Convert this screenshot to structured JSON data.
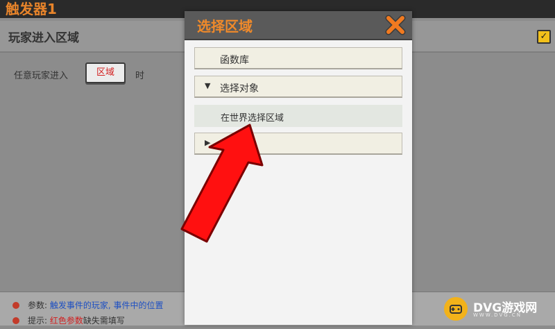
{
  "editor": {
    "title": "触发器1",
    "section_title": "玩家进入区域",
    "condition_prefix": "任意玩家进入",
    "area_button_label": "区域",
    "condition_suffix": "时",
    "enabled_check": "✓"
  },
  "footer": {
    "param_label": "参数:",
    "param_values": "触发事件的玩家, 事件中的位置",
    "hint_label": "提示:",
    "hint_red": "红色参数",
    "hint_rest": "缺失需填写"
  },
  "watermark": {
    "text": "DVG游戏网",
    "sub": "WWW.DVG.CN",
    "badge_icon": "gamepad-icon"
  },
  "popup": {
    "title": "选择区域",
    "close_icon": "close-icon",
    "items": [
      {
        "label": "函数库"
      },
      {
        "arrow": "▼",
        "label": "选择对象"
      },
      {
        "label": "在世界选择区域"
      },
      {
        "arrow": "▶",
        "label": ""
      }
    ]
  },
  "colors": {
    "accent_orange": "#f08a2a",
    "arrow_red": "#ff1010",
    "parameter_blue": "#1d4fc2"
  }
}
